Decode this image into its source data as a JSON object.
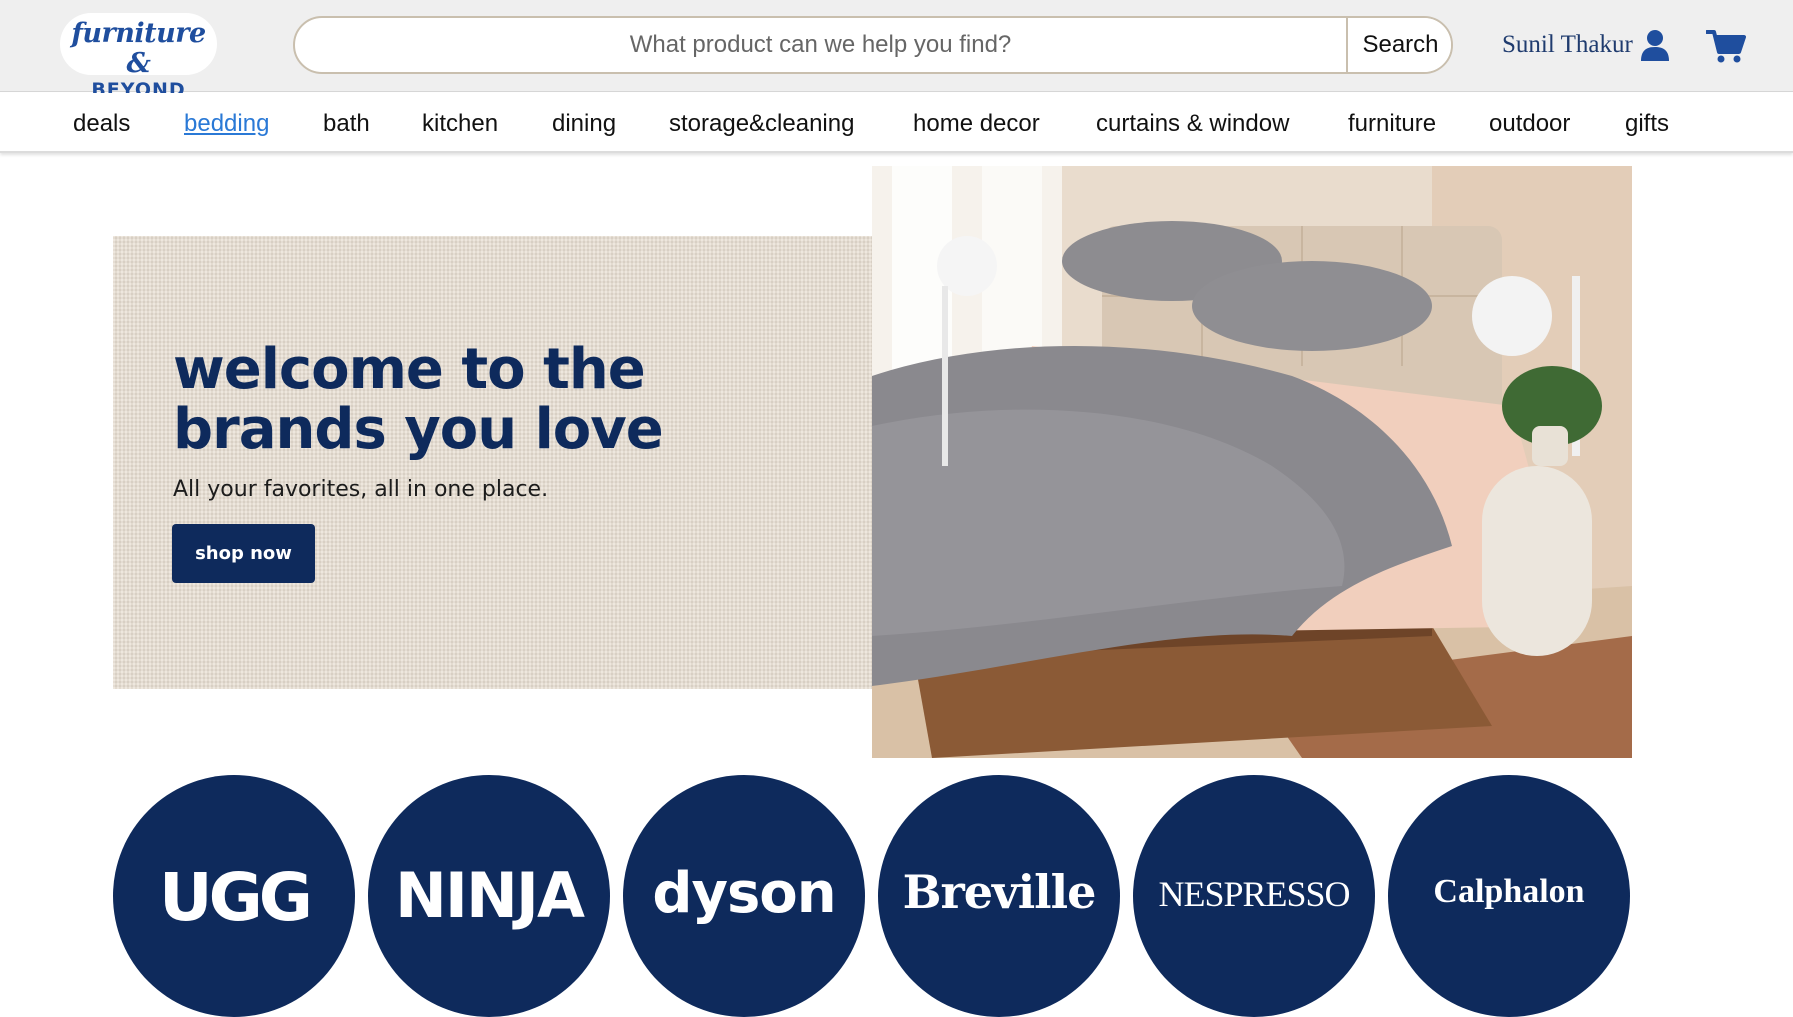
{
  "header": {
    "logo": {
      "line1": "furniture &",
      "line2": "BEYOND"
    },
    "search": {
      "placeholder": "What product can we help you find?",
      "button_label": "Search"
    },
    "user": {
      "name": "Sunil Thakur"
    },
    "icons": {
      "user": "user-icon",
      "cart": "cart-icon"
    },
    "colors": {
      "header_bg": "#efefef",
      "brand_blue": "#1f4e9e",
      "search_border": "#c9bfae"
    }
  },
  "nav": {
    "items": [
      {
        "label": "deals",
        "active": false
      },
      {
        "label": "bedding",
        "active": true
      },
      {
        "label": "bath",
        "active": false
      },
      {
        "label": "kitchen",
        "active": false
      },
      {
        "label": "dining",
        "active": false
      },
      {
        "label": "storage&cleaning",
        "active": false
      },
      {
        "label": "home decor",
        "active": false
      },
      {
        "label": "curtains & window",
        "active": false
      },
      {
        "label": "furniture",
        "active": false
      },
      {
        "label": "outdoor",
        "active": false
      },
      {
        "label": "gifts",
        "active": false
      }
    ],
    "colors": {
      "active": "#2a79d6"
    }
  },
  "hero": {
    "title_line1": "welcome to the",
    "title_line2": "brands you love",
    "subtitle": "All your favorites, all in one place.",
    "cta_label": "shop now",
    "image": "bedroom-photo",
    "colors": {
      "navy": "#0e2a5c",
      "linen": "#e6ddd0"
    }
  },
  "brands": [
    {
      "name": "UGG"
    },
    {
      "name": "NINJA"
    },
    {
      "name": "dyson"
    },
    {
      "name": "Breville"
    },
    {
      "name": "NESPRESSO"
    },
    {
      "name": "Calphalon"
    }
  ]
}
